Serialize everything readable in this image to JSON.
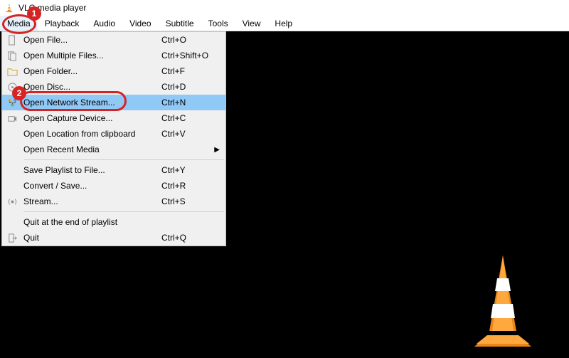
{
  "title": "VLC media player",
  "menubar": [
    "Media",
    "Playback",
    "Audio",
    "Video",
    "Subtitle",
    "Tools",
    "View",
    "Help"
  ],
  "media_menu": {
    "items": [
      {
        "icon": "file-icon",
        "label": "Open File...",
        "shortcut": "Ctrl+O"
      },
      {
        "icon": "files-icon",
        "label": "Open Multiple Files...",
        "shortcut": "Ctrl+Shift+O"
      },
      {
        "icon": "folder-icon",
        "label": "Open Folder...",
        "shortcut": "Ctrl+F"
      },
      {
        "icon": "disc-icon",
        "label": "Open Disc...",
        "shortcut": "Ctrl+D"
      },
      {
        "icon": "network-icon",
        "label": "Open Network Stream...",
        "shortcut": "Ctrl+N",
        "selected": true
      },
      {
        "icon": "capture-icon",
        "label": "Open Capture Device...",
        "shortcut": "Ctrl+C"
      },
      {
        "icon": "",
        "label": "Open Location from clipboard",
        "shortcut": "Ctrl+V"
      },
      {
        "icon": "",
        "label": "Open Recent Media",
        "shortcut": "",
        "submenu": true
      }
    ],
    "items2": [
      {
        "icon": "",
        "label": "Save Playlist to File...",
        "shortcut": "Ctrl+Y"
      },
      {
        "icon": "",
        "label": "Convert / Save...",
        "shortcut": "Ctrl+R"
      },
      {
        "icon": "stream-icon",
        "label": "Stream...",
        "shortcut": "Ctrl+S"
      }
    ],
    "items3": [
      {
        "icon": "",
        "label": "Quit at the end of playlist",
        "shortcut": ""
      },
      {
        "icon": "quit-icon",
        "label": "Quit",
        "shortcut": "Ctrl+Q"
      }
    ]
  },
  "annotations": {
    "one": "1",
    "two": "2"
  }
}
